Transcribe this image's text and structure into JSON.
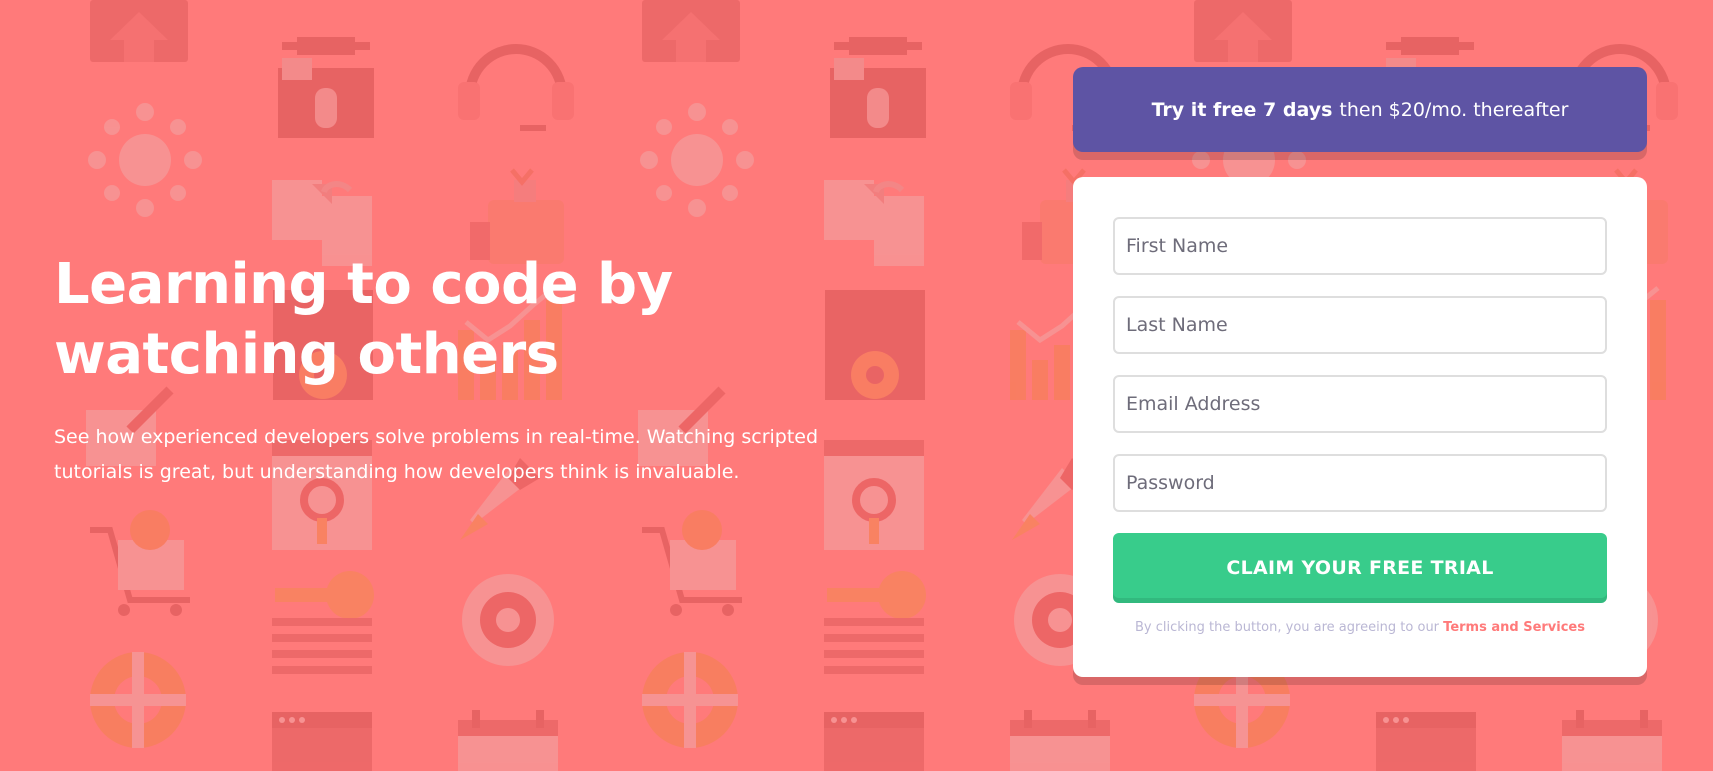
{
  "colors": {
    "background": "#ff7a7a",
    "offer_banner": "#5e54a4",
    "cta_button": "#38cc8b",
    "terms_link": "#ff7a7a",
    "terms_text": "#bab7d4"
  },
  "hero": {
    "title": "Learning to code by watching others",
    "description": "See how experienced developers solve problems in real-time. Watching scripted tutorials is great, but understanding how developers think is invaluable."
  },
  "offer": {
    "bold_text": "Try it free 7 days",
    "rest_text": "then $20/mo. thereafter"
  },
  "form": {
    "first_name": {
      "placeholder": "First Name",
      "value": ""
    },
    "last_name": {
      "placeholder": "Last Name",
      "value": ""
    },
    "email": {
      "placeholder": "Email Address",
      "value": ""
    },
    "password": {
      "placeholder": "Password",
      "value": ""
    },
    "submit_label": "CLAIM YOUR FREE TRIAL",
    "terms_prefix": "By clicking the button, you are agreeing to our",
    "terms_link": "Terms and Services"
  },
  "background_icons": [
    "home-icon",
    "toolbox-icon",
    "headset-icon",
    "network-icon",
    "documents-icon",
    "settings-panel-icon",
    "bar-chart-icon",
    "browser-search-icon",
    "rocket-icon",
    "cart-icon",
    "key-icon",
    "globe-gear-icon",
    "lifebuoy-icon",
    "calendar-icon",
    "window-icon"
  ]
}
